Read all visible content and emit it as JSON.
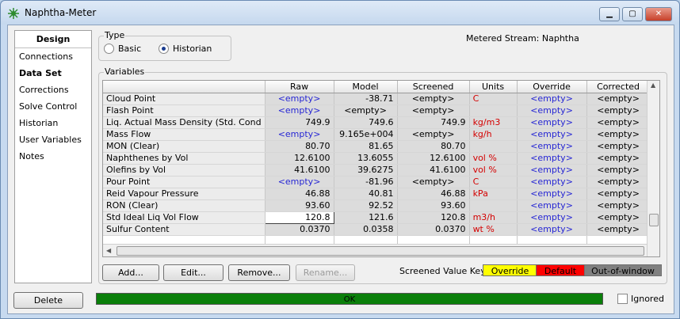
{
  "window": {
    "title": "Naphtha-Meter",
    "minimize": "▁",
    "maximize": "▢",
    "close": "✕"
  },
  "nav": {
    "header": "Design",
    "items": [
      {
        "label": "Connections",
        "active": false
      },
      {
        "label": "Data Set",
        "active": true
      },
      {
        "label": "Corrections",
        "active": false
      },
      {
        "label": "Solve Control",
        "active": false
      },
      {
        "label": "Historian",
        "active": false
      },
      {
        "label": "User Variables",
        "active": false
      },
      {
        "label": "Notes",
        "active": false
      }
    ]
  },
  "type_group": {
    "legend": "Type",
    "basic": "Basic",
    "historian": "Historian",
    "selected": "Historian"
  },
  "metered_stream": "Metered Stream: Naphtha",
  "variables": {
    "legend": "Variables",
    "columns": [
      "",
      "Raw",
      "Model",
      "Screened",
      "Units",
      "Override",
      "Corrected"
    ],
    "rows": [
      [
        "Cloud Point",
        "<empty>",
        "-38.71",
        "<empty>",
        "C",
        "<empty>",
        "<empty>"
      ],
      [
        "Flash Point",
        "<empty>",
        "<empty>",
        "<empty>",
        "",
        "<empty>",
        "<empty>"
      ],
      [
        "Liq. Actual Mass Density (Std. Cond",
        "749.9",
        "749.6",
        "749.9",
        "kg/m3",
        "<empty>",
        "<empty>"
      ],
      [
        "Mass Flow",
        "<empty>",
        "9.165e+004",
        "<empty>",
        "kg/h",
        "<empty>",
        "<empty>"
      ],
      [
        "MON (Clear)",
        "80.70",
        "81.65",
        "80.70",
        "",
        "<empty>",
        "<empty>"
      ],
      [
        "Naphthenes by Vol",
        "12.6100",
        "13.6055",
        "12.6100",
        "vol %",
        "<empty>",
        "<empty>"
      ],
      [
        "Olefins by Vol",
        "41.6100",
        "39.6275",
        "41.6100",
        "vol %",
        "<empty>",
        "<empty>"
      ],
      [
        "Pour Point",
        "<empty>",
        "-81.96",
        "<empty>",
        "C",
        "<empty>",
        "<empty>"
      ],
      [
        "Reid Vapour Pressure",
        "46.88",
        "40.81",
        "46.88",
        "kPa",
        "<empty>",
        "<empty>"
      ],
      [
        "RON (Clear)",
        "93.60",
        "92.52",
        "93.60",
        "",
        "<empty>",
        "<empty>"
      ],
      [
        "Std Ideal Liq Vol Flow",
        "120.8",
        "121.6",
        "120.8",
        "m3/h",
        "<empty>",
        "<empty>"
      ],
      [
        "Sulfur Content",
        "0.0370",
        "0.0358",
        "0.0370",
        "wt %",
        "<empty>",
        "<empty>"
      ]
    ]
  },
  "buttons": {
    "add": "Add...",
    "edit": "Edit...",
    "remove": "Remove...",
    "rename": "Rename..."
  },
  "screened_key": {
    "label": "Screened Value Key:",
    "override": {
      "label": "Override",
      "color": "#ffff00"
    },
    "default": {
      "label": "Default",
      "color": "#ff0000"
    },
    "out": {
      "label": "Out-of-window",
      "color": "#808080"
    }
  },
  "footer": {
    "delete": "Delete",
    "status": "OK",
    "status_color": "#0a7f0a",
    "ignored": "Ignored"
  }
}
